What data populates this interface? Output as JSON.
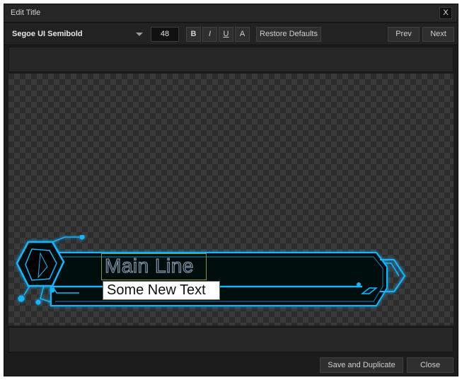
{
  "window": {
    "title": "Edit Title",
    "close_label": "X"
  },
  "toolbar": {
    "font_family": "Segoe UI Semibold",
    "font_size": "48",
    "bold_label": "B",
    "italic_label": "I",
    "underline_label": "U",
    "color_label": "A",
    "restore_label": "Restore Defaults",
    "prev_label": "Prev",
    "next_label": "Next"
  },
  "canvas": {
    "main_line": "Main Line",
    "sub_line": "Some New Text",
    "accent_color": "#19b6ff"
  },
  "footer": {
    "save_duplicate_label": "Save and Duplicate",
    "close_label": "Close"
  }
}
